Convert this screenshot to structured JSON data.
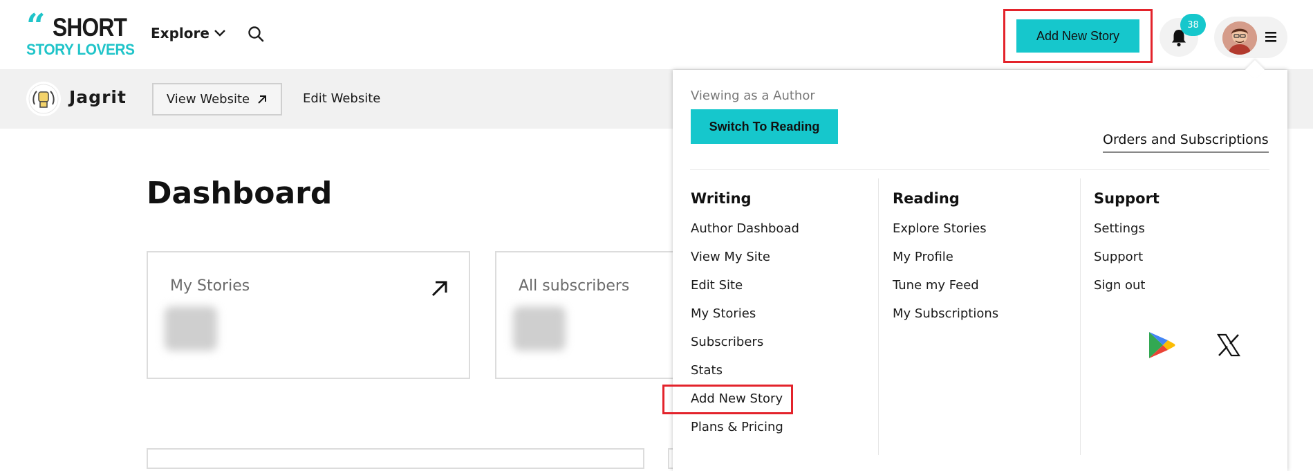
{
  "brand": {
    "quote_mark": "“",
    "line1": "SHORT",
    "line2": "STORY LOVERS",
    "accent_color": "#16c7cc"
  },
  "header": {
    "explore_label": "Explore",
    "add_story_label": "Add New Story",
    "notification_count": "38",
    "icons": [
      "search-icon",
      "bell-icon",
      "hamburger-menu-icon",
      "chevron-down-icon"
    ]
  },
  "subheader": {
    "site_name": "Jagrit",
    "view_website_label": "View Website",
    "edit_website_label": "Edit Website"
  },
  "dashboard": {
    "title": "Dashboard",
    "cards": [
      {
        "label": "My Stories"
      },
      {
        "label": "All subscribers"
      }
    ]
  },
  "menu": {
    "viewing_as": "Viewing as a Author",
    "switch_label": "Switch To Reading",
    "orders_label": "Orders and Subscriptions",
    "columns": [
      {
        "heading": "Writing",
        "items": [
          "Author Dashboad",
          "View My Site",
          "Edit Site",
          "My Stories",
          "Subscribers",
          "Stats",
          "Add New Story",
          "Plans & Pricing"
        ]
      },
      {
        "heading": "Reading",
        "items": [
          "Explore Stories",
          "My Profile",
          "Tune my Feed",
          "My Subscriptions"
        ]
      },
      {
        "heading": "Support",
        "items": [
          "Settings",
          "Support",
          "Sign out"
        ]
      }
    ],
    "app_icons": [
      "google-play-icon",
      "x-logo-icon"
    ]
  },
  "highlight_color": "#e3232b"
}
